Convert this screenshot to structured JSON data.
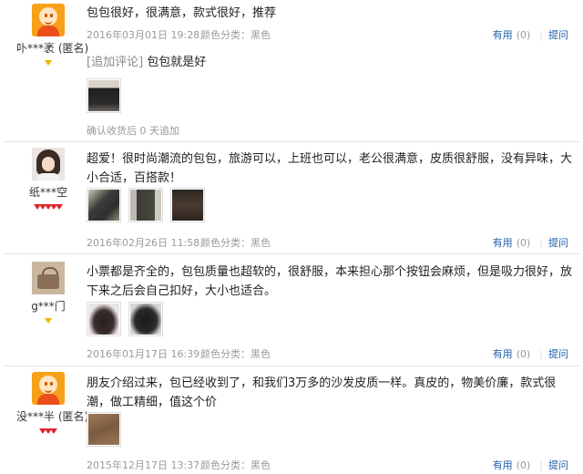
{
  "reviews": [
    {
      "username": "卟***袤 (匿名)",
      "badge": "gold",
      "content": "包包很好，很满意，款式很好，推荐",
      "date": "2016年03月01日 19:28",
      "variant": "颜色分类：黑色",
      "useful_label": "有用",
      "useful_count": "(0)",
      "ask_label": "提问",
      "append_label": "[追加评论]",
      "append_content": "包包就是好",
      "confirm_text": "确认收货后 0 天追加"
    },
    {
      "username": "纸***空",
      "badge": "red-5",
      "content": "超爱！很时尚潮流的包包，旅游可以，上班也可以，老公很满意，皮质很舒服，没有异味，大小合适，百搭款！",
      "date": "2016年02月26日 11:58",
      "variant": "颜色分类：黑色",
      "useful_label": "有用",
      "useful_count": "(0)",
      "ask_label": "提问"
    },
    {
      "username": "g***门",
      "badge": "gold",
      "content": "小票都是齐全的，包包质量也超软的，很舒服，本来担心那个按钮会麻烦，但是吸力很好，放下来之后会自己扣好，大小也适合。",
      "date": "2016年01月17日 16:39",
      "variant": "颜色分类：黑色",
      "useful_label": "有用",
      "useful_count": "(0)",
      "ask_label": "提问"
    },
    {
      "username": "没***半 (匿名)",
      "badge": "red-3",
      "content": "朋友介绍过来，包已经收到了，和我们3万多的沙发皮质一样。真皮的，物美价廉，款式很潮，做工精细，值这个价",
      "date": "2015年12月17日 13:37",
      "variant": "颜色分类：黑色",
      "useful_label": "有用",
      "useful_count": "(0)",
      "ask_label": "提问"
    }
  ],
  "colors": {
    "link": "#1f5ea8",
    "meta_gray": "#9a9a9a",
    "divider": "#e3e3e3",
    "gem_red": "#e0232b",
    "gem_gold": "#f1b400"
  }
}
